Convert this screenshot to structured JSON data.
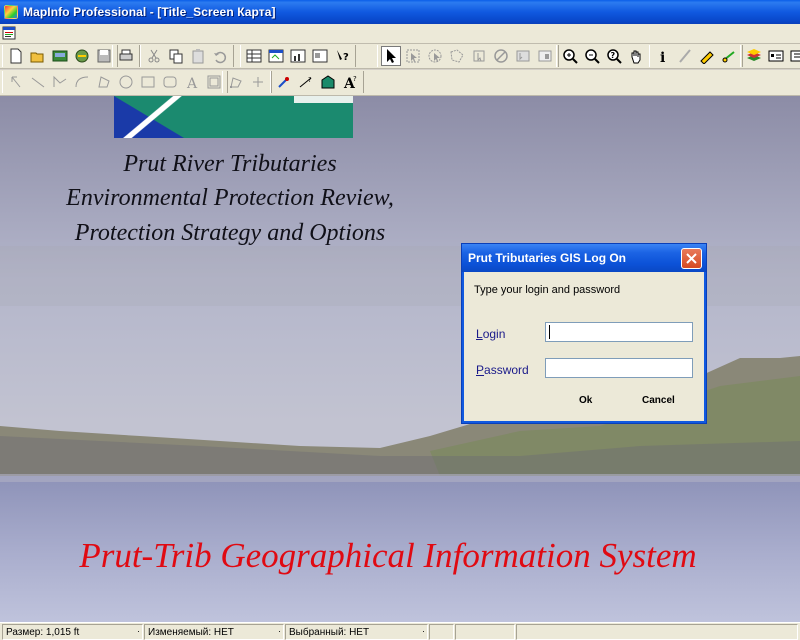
{
  "window": {
    "title": "MapInfo Professional - [Title_Screen Карта]"
  },
  "toolbars": {
    "main_icons": [
      "new-icon",
      "open-icon",
      "open-workspace-icon",
      "save-icon",
      "save-as-icon",
      "print-icon",
      "cut-icon",
      "copy-icon",
      "paste-icon",
      "undo-icon",
      "new-browser-icon",
      "new-mapper-icon",
      "new-grapher-icon",
      "new-layout-icon",
      "help-icon",
      "select-arrow-icon",
      "marquee-select-icon",
      "radius-select-icon",
      "polygon-select-icon",
      "boundary-select-icon",
      "unselect-icon",
      "invert-select-icon",
      "zoom-in-icon",
      "zoom-out-icon",
      "change-view-icon",
      "grabber-icon",
      "info-icon",
      "ruler-icon",
      "label-icon",
      "drag-map-icon",
      "layer-control-icon",
      "legend-icon",
      "statistics-icon"
    ],
    "drawing_icons": [
      "symbol-icon",
      "line-icon",
      "polyline-icon",
      "arc-icon",
      "polygon-icon",
      "ellipse-icon",
      "rectangle-icon",
      "rounded-rect-icon",
      "text-icon",
      "frame-icon",
      "reshape-icon",
      "add-node-icon",
      "symbol-style-icon",
      "line-style-icon",
      "region-style-icon",
      "text-style-icon"
    ]
  },
  "workspace": {
    "subtitle_lines": [
      "Prut River Tributaries",
      "Environmental Protection Review,",
      "Protection Strategy and Options"
    ],
    "main_title": "Prut-Trib Geographical Information System"
  },
  "dialog": {
    "title": "Prut Tributaries GIS Log On",
    "prompt": "Type your login and password",
    "login_label_first": "L",
    "login_label_rest": "ogin",
    "password_label_first": "P",
    "password_label_rest": "assword",
    "login_value": "",
    "password_value": "",
    "ok_label": "Ok",
    "cancel_label": "Cancel"
  },
  "statusbar": {
    "size": "Размер: 1,015 ft",
    "editable": "Изменяемый: НЕТ",
    "selected": "Выбранный: НЕТ"
  },
  "colors": {
    "accent": "#0a5ee8",
    "main_title": "#e00a12",
    "logo_green": "#1b8a6f",
    "logo_blue": "#1a3aa8"
  }
}
